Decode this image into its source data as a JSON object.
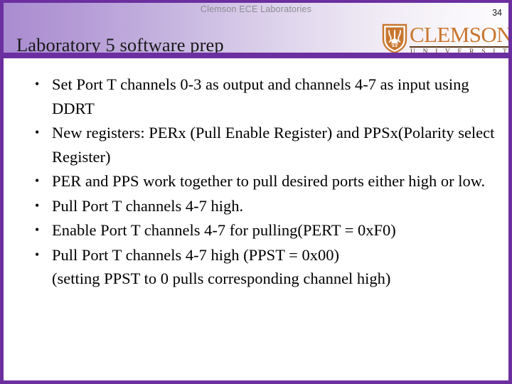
{
  "slide": {
    "kicker": "Clemson ECE Laboratories",
    "number": "34",
    "title": "Laboratory 5 software prep",
    "accent_color": "#6b2fa0",
    "header_gradient_from": "#a98cd0",
    "header_gradient_to": "#fdfcfe",
    "background_color": "#ffffff"
  },
  "logo": {
    "wordmark": "CLEMSON",
    "subtitle": "U N I V E R S I T Y",
    "mark_color": "#c8762e",
    "rule_color": "#5a3a1e"
  },
  "bullets": [
    {
      "text": "Set Port T channels 0-3 as output and channels 4-7 as input using DDRT",
      "continuation": ""
    },
    {
      "text": "New registers: PERx (Pull Enable Register) and PPSx(Polarity select Register)",
      "continuation": ""
    },
    {
      "text": "PER and PPS work together to pull desired ports either high or low.",
      "continuation": ""
    },
    {
      "text": "Pull Port T channels 4-7 high.",
      "continuation": ""
    },
    {
      "text": "Enable Port T channels 4-7 for pulling(PERT = 0xF0)",
      "continuation": ""
    },
    {
      "text": "Pull Port T channels 4-7 high (PPST = 0x00)",
      "continuation": "(setting PPST to 0 pulls corresponding channel high)"
    }
  ]
}
